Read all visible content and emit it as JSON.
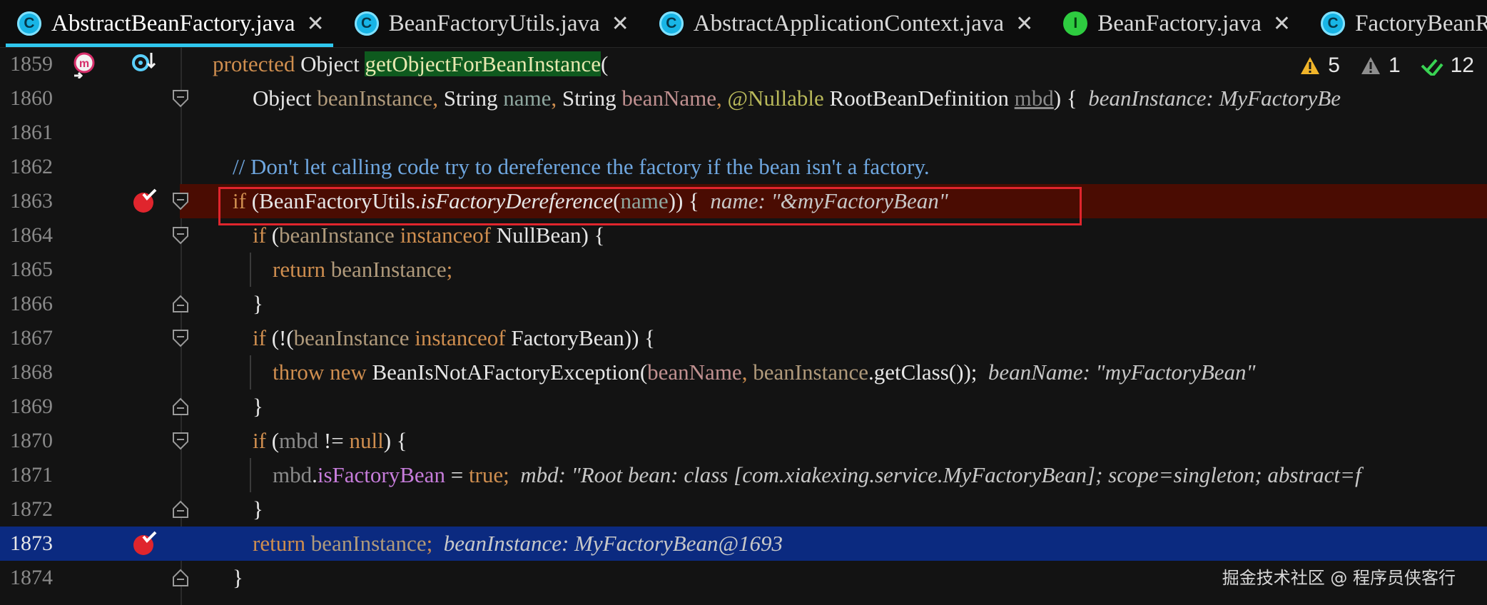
{
  "tabs": [
    {
      "label": "AbstractBeanFactory.java",
      "icon": "class-icon",
      "active": true
    },
    {
      "label": "BeanFactoryUtils.java",
      "icon": "class-icon",
      "active": false
    },
    {
      "label": "AbstractApplicationContext.java",
      "icon": "class-icon",
      "active": false
    },
    {
      "label": "BeanFactory.java",
      "icon": "interface-icon",
      "active": false
    },
    {
      "label": "FactoryBeanRe",
      "icon": "class-icon",
      "active": false
    }
  ],
  "inspections": {
    "warnings": "5",
    "weak_warnings": "1",
    "ok": "12"
  },
  "lines": {
    "n1859": "1859",
    "n1860": "1860",
    "n1861": "1861",
    "n1862": "1862",
    "n1863": "1863",
    "n1864": "1864",
    "n1865": "1865",
    "n1866": "1866",
    "n1867": "1867",
    "n1868": "1868",
    "n1869": "1869",
    "n1870": "1870",
    "n1871": "1871",
    "n1872": "1872",
    "n1873": "1873",
    "n1874": "1874"
  },
  "code": {
    "l1859_kw": "protected",
    "l1859_type": " Object ",
    "l1859_method": "getObjectForBeanInstance",
    "l1859_paren": "(",
    "l1860_t1": "Object ",
    "l1860_p1": "beanInstance",
    "l1860_c1": ", ",
    "l1860_t2": "String ",
    "l1860_p2": "name",
    "l1860_c2": ", ",
    "l1860_t3": "String ",
    "l1860_p3": "beanName",
    "l1860_c3": ", ",
    "l1860_ann": "@Nullable",
    "l1860_t4": " RootBeanDefinition ",
    "l1860_p4": "mbd",
    "l1860_end": ") {",
    "l1860_hint": "beanInstance: MyFactoryBe",
    "l1862_comment": "// Don't let calling code try to dereference the factory if the bean isn't a factory.",
    "l1863_kw": "if",
    "l1863_a": " (BeanFactoryUtils.",
    "l1863_fn": "isFactoryDereference",
    "l1863_b": "(",
    "l1863_p": "name",
    "l1863_c": ")) {",
    "l1863_hint": "name: \"&myFactoryBean\"",
    "l1864_kw": "if",
    "l1864_a": " (",
    "l1864_p": "beanInstance",
    "l1864_kw2": " instanceof",
    "l1864_b": " NullBean) {",
    "l1865_kw": "return",
    "l1865_p": " beanInstance",
    "l1865_semi": ";",
    "l1866_brace": "}",
    "l1867_kw": "if",
    "l1867_a": " (!(",
    "l1867_p": "beanInstance",
    "l1867_kw2": " instanceof",
    "l1867_b": " FactoryBean)) {",
    "l1868_kw": "throw new",
    "l1868_a": " BeanIsNotAFactoryException(",
    "l1868_p1": "beanName",
    "l1868_c": ", ",
    "l1868_p2": "beanInstance",
    "l1868_b": ".getClass());",
    "l1868_hint": "beanName: \"myFactoryBean\"",
    "l1869_brace": "}",
    "l1870_kw": "if",
    "l1870_a": " (",
    "l1870_p": "mbd",
    "l1870_b": " != ",
    "l1870_kw2": "null",
    "l1870_c": ") {",
    "l1871_p": "mbd",
    "l1871_dot": ".",
    "l1871_f": "isFactoryBean",
    "l1871_eq": " = ",
    "l1871_kw": "true",
    "l1871_semi": ";",
    "l1871_hint": "mbd: \"Root bean: class [com.xiakexing.service.MyFactoryBean]; scope=singleton; abstract=f",
    "l1872_brace": "}",
    "l1873_kw": "return",
    "l1873_p": " beanInstance",
    "l1873_semi": ";",
    "l1873_hint": "beanInstance: MyFactoryBean@1693",
    "l1874_brace": "}"
  },
  "watermark": "掘金技术社区 @ 程序员侠客行",
  "colors": {
    "background": "#131313",
    "breakpoint_line": "#4a0c02",
    "execution_line": "#0b2a80",
    "tab_accent": "#2fc7ee",
    "keyword": "#cf8e4f",
    "comment": "#6fa7e0",
    "parameter": "#b09a7b",
    "annotation": "#b9b95a",
    "field": "#c77ddb",
    "breakpoint_red": "#e0252d"
  }
}
